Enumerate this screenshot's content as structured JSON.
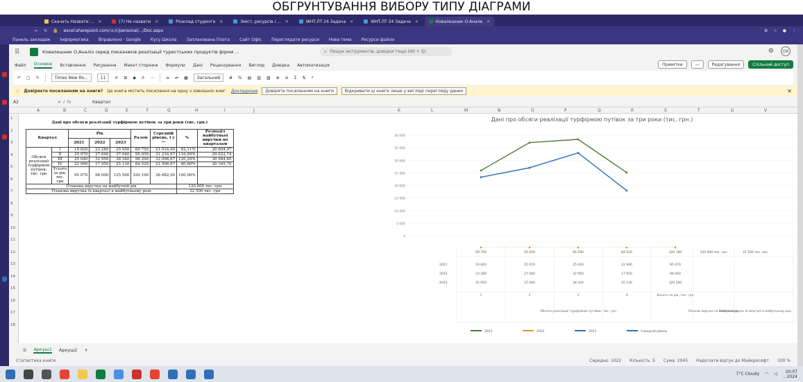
{
  "header_caption": "ОБГРУНТУВАННЯ ВИБОРУ ТИПУ ДІАГРАМИ",
  "browser": {
    "tabs": [
      {
        "label": "Скачать Назвати ...",
        "color": "#f2c94c"
      },
      {
        "label": "(7) Не назвати",
        "color": "#d0312d"
      },
      {
        "label": "Розклад студента",
        "color": "#4a90e2"
      },
      {
        "label": "Зміст, ресурсів і ...",
        "color": "#4a90e2"
      },
      {
        "label": "WHT.ЛТ 24 Задача",
        "color": "#4a90e2"
      },
      {
        "label": "WHT.ЛТ 24 Задача",
        "color": "#4a90e2"
      },
      {
        "label": "Ковалешник О.Анале",
        "color": "#107c41",
        "active": true
      }
    ],
    "url": "excel.sharepoint.com/:x:/r/personal/.../Doc.aspx",
    "url_host": "sharepoint.com",
    "bookmarks": [
      "Панель закладок",
      "Інформатика",
      "Вправлено · Google",
      "Кусу Школа",
      "Запланована Плата",
      "Сайт Офіс",
      "Переглядати ресурси",
      "Нова тема",
      "Ресурси файли"
    ]
  },
  "excel": {
    "doc_title": "Ковалешник О.Аналіз серед показників реалізації туристських продуктів фірми ...",
    "search_placeholder": "Пошук інструментів, довідки тощо (Alt + Q)",
    "menu": [
      "Файл",
      "Основне",
      "Вставлення",
      "Рисування",
      "Макет сторінки",
      "Формули",
      "Дані",
      "Рецензування",
      "Вигляд",
      "Довідка",
      "Автоматизація"
    ],
    "menu_active": "Основне",
    "comments_label": "Примітки",
    "editing_label": "Редагування",
    "share_label": "Спільний доступ",
    "ribbon": {
      "font_name": "Times New Ro...",
      "font_size": "11",
      "number_format": "Загальний"
    },
    "warning": {
      "title": "Довіряєте посиланням на книги?",
      "text": "Це книга містить посилання на одну з зовнішніх книг.",
      "link": "Докладніше",
      "btn1": "Довіряти посиланням на книги",
      "btn2": "Відкривати ці книги лише у вигляді перегляду даних"
    },
    "name_box": "A2",
    "formula": "Квартал",
    "columns": [
      "A",
      "B",
      "C",
      "D",
      "E",
      "F",
      "G",
      "H",
      "I",
      "J",
      "K",
      "L",
      "M",
      "N",
      "O",
      "P",
      "Q",
      "R",
      "S",
      "T",
      "U",
      "V"
    ],
    "rows": [
      "1",
      "2",
      "3",
      "4",
      "5",
      "6",
      "7",
      "8",
      "9",
      "10",
      "11",
      "12",
      "13",
      "14",
      "15",
      "16",
      "17",
      "18"
    ],
    "sheets": [
      "Аркуш1",
      "Аркуш2"
    ],
    "status_left": "Статистика книги",
    "status_right": [
      "Середнє: 1022",
      "Кількість: 5",
      "Сума: 2045",
      "Надіслати відгук до Майкрософт",
      "100 %"
    ]
  },
  "table": {
    "title": "Дані про обсяги реалізації турфірмою путівок за три роки (тис. грн.)",
    "h_quarter": "Квартал",
    "h_year": "Рік",
    "years": [
      "2021",
      "2022",
      "2023"
    ],
    "h_sum": "Разом",
    "h_avg": "Середній рівень, і у—",
    "h_pct": "%",
    "h_fcast": "Розподіл майбутньої виручки по кварталам",
    "row_label": "Обсяги реалізації турфірмою путівок, тис. грн",
    "quarters": [
      "I",
      "II",
      "III",
      "IV"
    ],
    "rows": [
      [
        "19 820",
        "23 280",
        "25 950",
        "69 750",
        "21 916,00",
        "82,11%",
        "20 604,97"
      ],
      [
        "25 970",
        "27 040",
        "37 040",
        "95 050",
        "31 216,67",
        "116,99%",
        "29 022,74"
      ],
      [
        "25 040",
        "32 950",
        "38 340",
        "96 290",
        "32 096,67",
        "120,29%",
        "30 084,60"
      ],
      [
        "22 990",
        "17 950",
        "25 130",
        "64 520",
        "21 506,67",
        "80,60%",
        "20 165,70"
      ]
    ],
    "total_label": "Усього за рік, тис. грн",
    "totals": [
      "95 070",
      "98 000",
      "125 500",
      "320 190",
      "26 682,50",
      "100,00%"
    ],
    "plan_label": "Планова виручка на майбутній рік",
    "plan_value": "120 000 тис. грн",
    "plan_q_label": "Планова виручка (в квартал) в майбутньому році",
    "plan_q_value": "32 500 тис. грн"
  },
  "chart_data": {
    "type": "line",
    "title": "Дані про обсяги реалізації турфірмою путівок за три роки (тис. грн.)",
    "categories": [
      "1",
      "2",
      "3",
      "4",
      "Всього за рік, тис. грн"
    ],
    "ylim": [
      0,
      40000
    ],
    "series": [
      {
        "name": "2023",
        "values": [
          25950,
          37040,
          38340,
          25130,
          null
        ],
        "color": "#4e7a38"
      },
      {
        "name": "2022",
        "values": [
          23280,
          27040,
          32950,
          17950,
          null
        ],
        "color": "#2f6fb8"
      },
      {
        "name": "2021",
        "values": [
          19820,
          25970,
          25040,
          22990,
          null
        ],
        "color": "#f28e2b"
      }
    ],
    "extra_line": {
      "name": "Середній рівень",
      "values": [
        21916,
        31216.67,
        32096.67,
        21506.67,
        26682.5
      ],
      "color": "#2f6fb8"
    },
    "pct_row": [
      "82,11%",
      "116,99%",
      "120,29%",
      "80,60%",
      "100,00%"
    ],
    "header_row": [
      "69 750",
      "95 050",
      "96 290",
      "64 520",
      "320 190",
      "120 000 тис. грн",
      "32 500 тис. грн"
    ],
    "x_axis_label": "Обсяги реалізації турфірмою путівок, тис. грн",
    "side_labels": [
      "Планова виручка на майбутній рік",
      "Планова виручка (в квартал) в майбутньому році"
    ],
    "legend": [
      "2023",
      "2022",
      "2021",
      "Середній рівень"
    ],
    "table_rows": [
      {
        "year": "2021",
        "values": [
          "19 820",
          "25 970",
          "25 040",
          "22 990",
          "95 070"
        ]
      },
      {
        "year": "2022",
        "values": [
          "23 280",
          "27 040",
          "32 950",
          "17 950",
          "98 000"
        ]
      },
      {
        "year": "2023",
        "values": [
          "25 950",
          "37 040",
          "38 340",
          "25 130",
          "125 500"
        ]
      }
    ]
  },
  "taskbar": {
    "icons": [
      {
        "name": "windows-start-icon",
        "color": "#2f6fb8"
      },
      {
        "name": "search-icon",
        "color": "#444"
      },
      {
        "name": "task-view-icon",
        "color": "#555"
      },
      {
        "name": "chrome-icon",
        "color": "#e94235"
      },
      {
        "name": "files-icon",
        "color": "#f2c94c"
      },
      {
        "name": "excel-icon",
        "color": "#107c41"
      },
      {
        "name": "chrome2-icon",
        "color": "#4a90e2"
      },
      {
        "name": "opera-icon",
        "color": "#d0312d"
      },
      {
        "name": "ring-icon",
        "color": "#e94235"
      },
      {
        "name": "photos-icon",
        "color": "#2f6fb8"
      },
      {
        "name": "app-icon",
        "color": "#2f6fb8"
      },
      {
        "name": "mail-icon",
        "color": "#2f6fb8"
      }
    ],
    "weather": "7°C Cloudy",
    "time": "20:07",
    "date": "...2024"
  }
}
